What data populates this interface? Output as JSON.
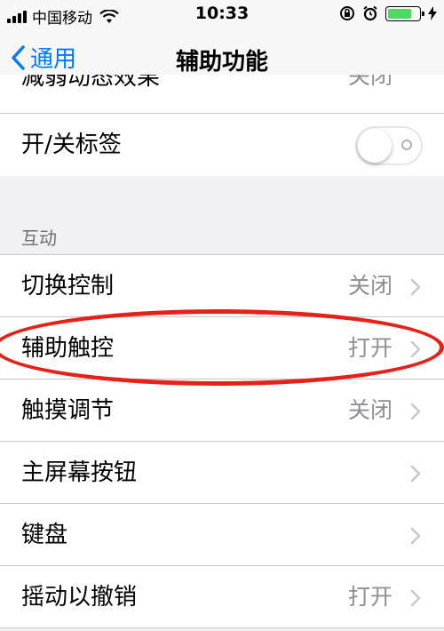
{
  "status_bar": {
    "carrier": "中国移动",
    "time": "10:33"
  },
  "nav": {
    "back_label": "通用",
    "title": "辅助功能"
  },
  "top_partial_row": {
    "label": "减弱动态效果",
    "value": "关闭"
  },
  "onoff_labels_row": {
    "label": "开/关标签",
    "toggle_on": false
  },
  "interaction_section": {
    "header": "互动",
    "items": [
      {
        "label": "切换控制",
        "value": "关闭"
      },
      {
        "label": "辅助触控",
        "value": "打开"
      },
      {
        "label": "触摸调节",
        "value": "关闭"
      },
      {
        "label": "主屏幕按钮",
        "value": ""
      },
      {
        "label": "键盘",
        "value": ""
      },
      {
        "label": "摇动以撤销",
        "value": "打开"
      }
    ]
  },
  "colors": {
    "accent": "#007aff",
    "annotation": "#e62117",
    "battery": "#4cd964"
  },
  "battery_level": 0.8
}
